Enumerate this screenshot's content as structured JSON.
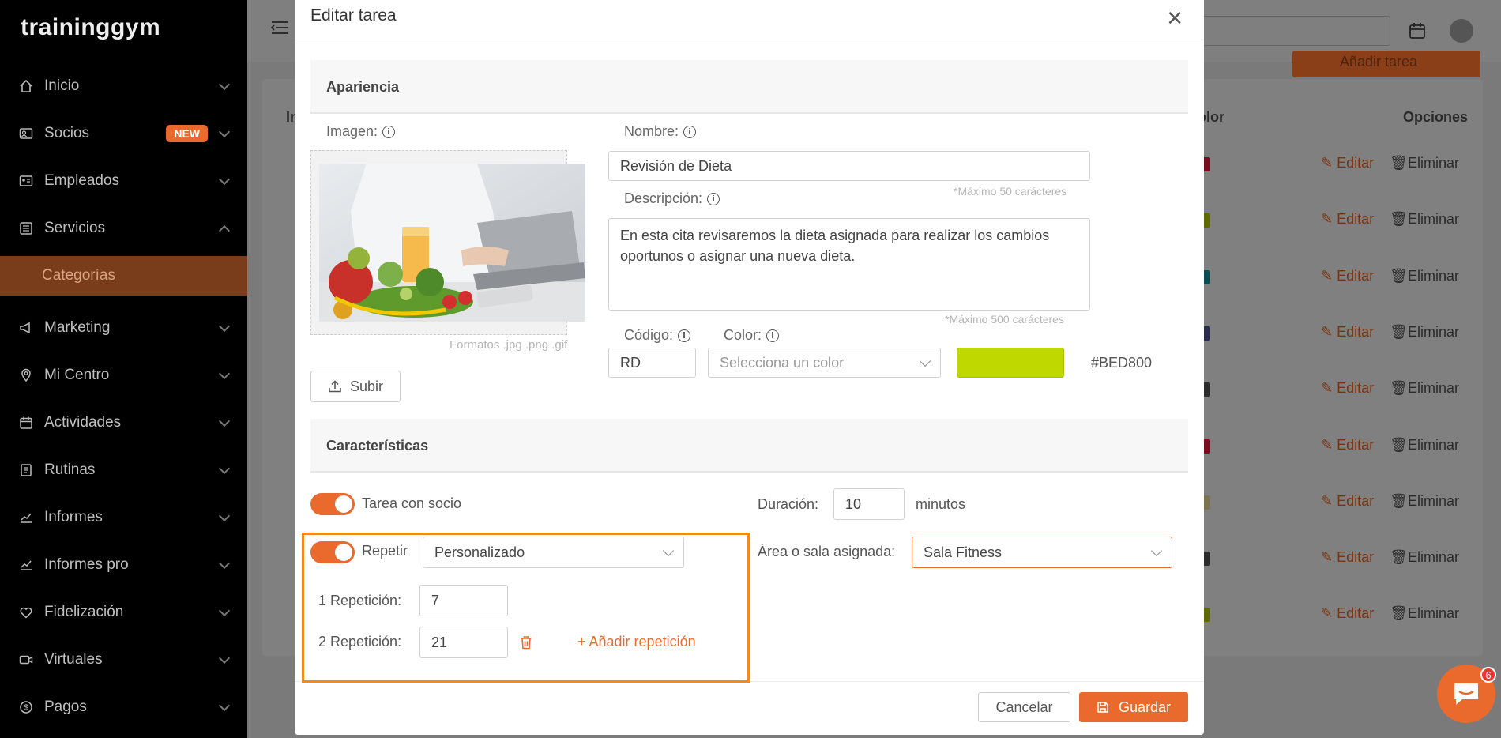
{
  "sidebar": {
    "logo": "traininggym",
    "items": [
      {
        "label": "Inicio",
        "icon": "home-icon"
      },
      {
        "label": "Socios",
        "icon": "id-card-icon",
        "badge": "NEW"
      },
      {
        "label": "Empleados",
        "icon": "employee-card-icon"
      },
      {
        "label": "Servicios",
        "icon": "list-icon"
      },
      {
        "label": "Categorías"
      },
      {
        "label": "Marketing",
        "icon": "megaphone-icon"
      },
      {
        "label": "Mi Centro",
        "icon": "location-pin-icon"
      },
      {
        "label": "Actividades",
        "icon": "calendar-icon"
      },
      {
        "label": "Rutinas",
        "icon": "document-icon"
      },
      {
        "label": "Informes",
        "icon": "chart-icon"
      },
      {
        "label": "Informes pro",
        "icon": "chart-pro-icon"
      },
      {
        "label": "Fidelización",
        "icon": "heart-icon"
      },
      {
        "label": "Virtuales",
        "icon": "video-icon"
      },
      {
        "label": "Pagos",
        "icon": "dollar-icon"
      }
    ]
  },
  "background": {
    "add_button": "Añadir tarea",
    "col_first": "In",
    "col_color": "olor",
    "col_options": "Opciones",
    "edit_label": "Editar",
    "delete_label": "Eliminar",
    "row_colors": [
      "#7a0a1e",
      "#5e6b00",
      "#0b4f55",
      "#2b2b4e",
      "#2b2b2b",
      "#7a0a1e",
      "#7a7450",
      "#2b2b2b",
      "#5e6b00"
    ]
  },
  "modal": {
    "title": "Editar tarea",
    "section_appearance": "Apariencia",
    "image_label": "Imagen:",
    "formats_hint": "Formatos .jpg .png .gif",
    "upload_button": "Subir",
    "name_label": "Nombre:",
    "name_value": "Revisión de Dieta",
    "name_hint": "*Máximo 50 carácteres",
    "description_label": "Descripción:",
    "description_value": "En esta cita revisaremos la dieta asignada para realizar los cambios oportunos o asignar una nueva dieta.",
    "description_hint": "*Máximo 500 carácteres",
    "code_label": "Código:",
    "code_value": "RD",
    "color_label": "Color:",
    "color_placeholder": "Selecciona un color",
    "color_swatch": "#BED800",
    "color_hex": "#BED800",
    "section_features": "Características",
    "task_with_member": "Tarea con socio",
    "duration_label": "Duración:",
    "duration_value": "10",
    "duration_unit": "minutos",
    "repeat_label": "Repetir",
    "repeat_value": "Personalizado",
    "area_label": "Área o sala asignada:",
    "area_value": "Sala Fitness",
    "rep1_label": "1 Repetición:",
    "rep1_value": "7",
    "rep2_label": "2 Repetición:",
    "rep2_value": "21",
    "add_repetition": "+ Añadir repetición",
    "cancel_button": "Cancelar",
    "save_button": "Guardar"
  },
  "chat": {
    "badge": "6"
  },
  "colors": {
    "accent": "#EA6A2E",
    "highlight": "#F28A1C"
  }
}
